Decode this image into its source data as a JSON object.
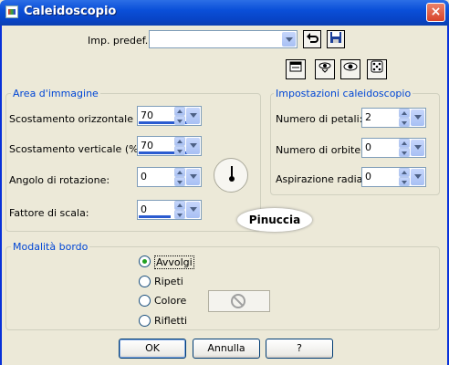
{
  "window": {
    "title": "Caleidoscopio",
    "close_label": "×"
  },
  "preset": {
    "label": "Imp. predef.:",
    "value": ""
  },
  "area": {
    "title": "Area d'immagine",
    "fields": [
      {
        "label": "Scostamento orizzontale (%):",
        "value": "70",
        "bar_fraction": 0.95
      },
      {
        "label": "Scostamento verticale (%):",
        "value": "70",
        "bar_fraction": 0.95
      },
      {
        "label": "Angolo di rotazione:",
        "value": "0",
        "bar_fraction": 0
      },
      {
        "label": "Fattore di scala:",
        "value": "0",
        "bar_fraction": 0.5
      }
    ]
  },
  "kaleido": {
    "title": "Impostazioni caleidoscopio",
    "fields": [
      {
        "label": "Numero di petali:",
        "value": "2"
      },
      {
        "label": "Numero di orbite:",
        "value": "0"
      },
      {
        "label": "Aspirazione radiale:",
        "value": "0"
      }
    ]
  },
  "logo_text": "Pinuccia",
  "border_mode": {
    "title": "Modalità bordo",
    "options": [
      "Avvolgi",
      "Ripeti",
      "Colore",
      "Rifletti"
    ],
    "selected": "Avvolgi"
  },
  "buttons": {
    "ok": "OK",
    "cancel": "Annulla",
    "help": "?"
  },
  "colors": {
    "title_bar": "#0a4fd8",
    "group_title": "#0046d5",
    "dialog_bg": "#ece9d8"
  }
}
